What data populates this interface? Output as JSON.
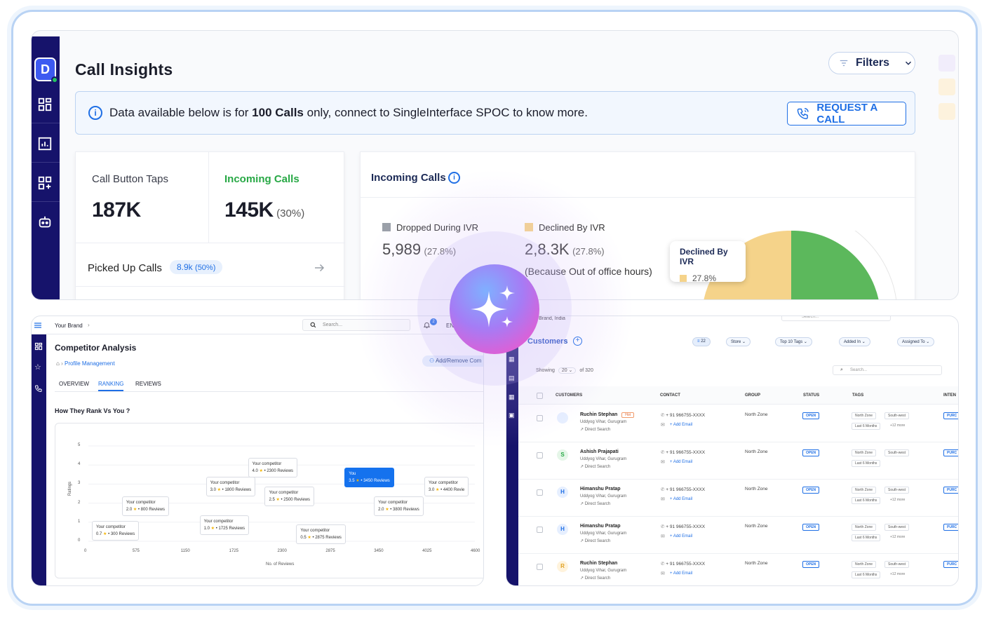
{
  "top": {
    "title": "Call Insights",
    "avatar_letter": "D",
    "filters_label": "Filters",
    "banner": {
      "text_before": "Data available below is for ",
      "bold": "100 Calls",
      "text_after": " only, connect to SingleInterface SPOC to know more.",
      "button": "REQUEST A CALL"
    },
    "stats": {
      "call_button_taps_label": "Call Button Taps",
      "call_button_taps_value": "187K",
      "incoming_calls_label": "Incoming Calls",
      "incoming_calls_value": "145K",
      "incoming_calls_pct": "(30%)",
      "picked_up_label": "Picked Up Calls",
      "picked_up_value": "8.9k",
      "picked_up_pct": "(50%)"
    },
    "incoming": {
      "title": "Incoming Calls",
      "dropped_label": "Dropped During IVR",
      "dropped_value": "5,989",
      "dropped_pct": "(27.8%)",
      "declined_label": "Declined By IVR",
      "declined_value": "2,8.3K",
      "declined_pct": "(27.8%)",
      "declined_note": "(Because Out of office hours)",
      "tooltip_title": "Declined By IVR",
      "tooltip_value": "27.8%"
    },
    "colors": {
      "dropped": "#9aa0a8",
      "declined": "#f5d38a",
      "green": "#5cb85c",
      "accent": "#1f6fe5",
      "navy": "#16136b"
    }
  },
  "competitor": {
    "brand": "Your Brand",
    "search_placeholder": "Search...",
    "notif_count": "2",
    "lang": "EN",
    "title": "Competitor Analysis",
    "breadcrumb": "Profile Management",
    "add_remove": "Add/Remove Com",
    "tabs": [
      "OVERVIEW",
      "RANKING",
      "REVIEWS"
    ],
    "section": "How They Rank Vs You ?",
    "chart_data": {
      "type": "scatter",
      "title": "How They Rank Vs You ?",
      "xlabel": "No. of Reviews",
      "ylabel": "Ratings",
      "xticks": [
        "0",
        "575",
        "1150",
        "1725",
        "2300",
        "2875",
        "3450",
        "4025",
        "4600"
      ],
      "yticks": [
        "0",
        "1",
        "2",
        "3",
        "4",
        "5"
      ],
      "xlim": [
        0,
        4600
      ],
      "ylim": [
        0,
        5
      ],
      "points": [
        {
          "name": "Your competitor",
          "rating": "0.7",
          "reviews": "300 Reviews"
        },
        {
          "name": "Your competitor",
          "rating": "2.0",
          "reviews": "800 Reviews"
        },
        {
          "name": "Your competitor",
          "rating": "1.0",
          "reviews": "1725 Reviews"
        },
        {
          "name": "Your competitor",
          "rating": "3.0",
          "reviews": "1800 Reviews"
        },
        {
          "name": "Your competitor",
          "rating": "4.0",
          "reviews": "2300 Reviews"
        },
        {
          "name": "Your competitor",
          "rating": "2.5",
          "reviews": "2500 Reviews"
        },
        {
          "name": "Your competitor",
          "rating": "0.5",
          "reviews": "2875 Reviews"
        },
        {
          "name": "You",
          "rating": "3.5",
          "reviews": "3450 Reviews"
        },
        {
          "name": "Your competitor",
          "rating": "2.0",
          "reviews": "3800 Reviews"
        },
        {
          "name": "Your competitor",
          "rating": "3.0",
          "reviews": "4400 Revie"
        }
      ]
    }
  },
  "customers": {
    "brand": "Your Brand, India",
    "search_placeholder": "Search...",
    "title": "Customers",
    "filter_count": "22",
    "filters": [
      "Store",
      "Top 10 Tags",
      "Added In",
      "Assigned To"
    ],
    "showing_label": "Showing",
    "page_size": "20",
    "of_total": "of 320",
    "columns": [
      "CUSTOMERS",
      "CONTACT",
      "GROUP",
      "STATUS",
      "TAGS",
      "INTEN"
    ],
    "rows": [
      {
        "name": "Ruchin Stephan",
        "badge": "Hot",
        "address": "Uddyog Vihar, Gurugram",
        "source": "Direct Search",
        "avatar": "",
        "phone": "+ 91 966755-XXXX",
        "email": "+ Add Email",
        "group": "North Zone",
        "status": "OPEN",
        "tags": [
          "North Zone",
          "South-west",
          "Last 6 Months",
          "+12 more"
        ],
        "intent": "PURC"
      },
      {
        "name": "Ashish Prajapati",
        "badge": "",
        "address": "Uddyog Vihar, Gurugram",
        "source": "Direct Search",
        "avatar": "S",
        "phone": "+ 91 966755-XXXX",
        "email": "+ Add Email",
        "group": "North Zone",
        "status": "OPEN",
        "tags": [
          "North Zone",
          "South-west",
          "Last 6 Months",
          ""
        ],
        "intent": "PURC"
      },
      {
        "name": "Himanshu Pratap",
        "badge": "",
        "address": "Uddyog Vihar, Gurugram",
        "source": "Direct Search",
        "avatar": "H",
        "phone": "+ 91 966755-XXXX",
        "email": "+ Add Email",
        "group": "North Zone",
        "status": "OPEN",
        "tags": [
          "North Zone",
          "South-west",
          "Last 6 Months",
          "+12 more"
        ],
        "intent": "PURC"
      },
      {
        "name": "Himanshu Pratap",
        "badge": "",
        "address": "Uddyog Vihar, Gurugram",
        "source": "Direct Search",
        "avatar": "H",
        "phone": "+ 91 966755-XXXX",
        "email": "+ Add Email",
        "group": "North Zone",
        "status": "OPEN",
        "tags": [
          "North Zone",
          "South-west",
          "Last 6 Months",
          "+12 more"
        ],
        "intent": "PURC"
      },
      {
        "name": "Ruchin Stephan",
        "badge": "",
        "address": "Uddyog Vihar, Gurugram",
        "source": "Direct Search",
        "avatar": "R",
        "phone": "+ 91 966755-XXXX",
        "email": "+ Add Email",
        "group": "North Zone",
        "status": "OPEN",
        "tags": [
          "North Zone",
          "South-west",
          "Last 6 Months",
          "+12 more"
        ],
        "intent": "PURC"
      }
    ]
  }
}
